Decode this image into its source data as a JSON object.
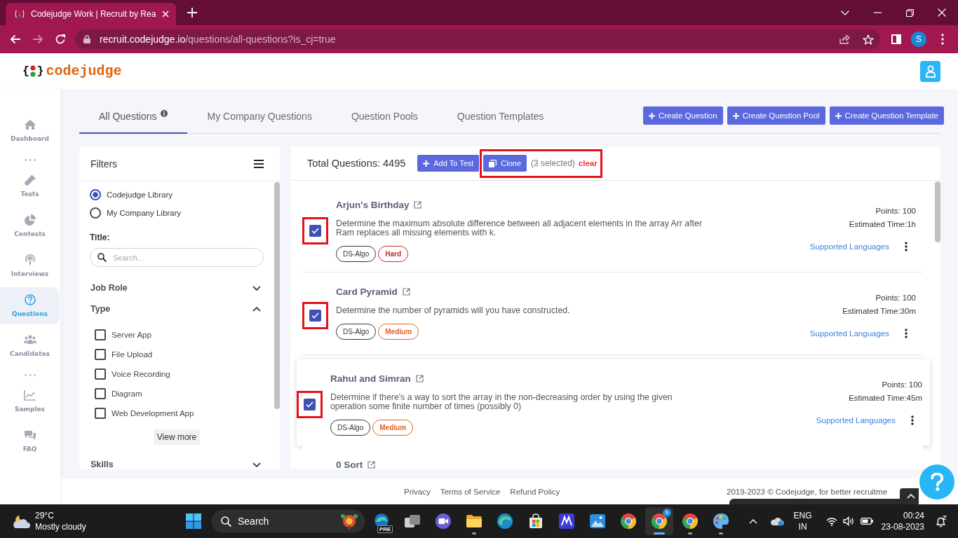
{
  "browser": {
    "tab": {
      "title": "Codejudge Work | Recruit by Rea"
    },
    "address": {
      "host": "recruit.codejudge.io",
      "path": "/questions/all-questions?is_cj=true"
    },
    "profile": "S"
  },
  "header": {
    "logo": {
      "open": "{",
      "close": "}",
      "name": "codejudge"
    }
  },
  "sidebar": {
    "items": [
      {
        "kind": "link",
        "label": "Dashboard",
        "selected": false
      },
      {
        "kind": "dots"
      },
      {
        "kind": "link",
        "label": "Tests",
        "selected": false
      },
      {
        "kind": "link",
        "label": "Contests",
        "selected": false
      },
      {
        "kind": "link",
        "label": "Interviews",
        "selected": false
      },
      {
        "kind": "link",
        "label": "Questions",
        "selected": true
      },
      {
        "kind": "link",
        "label": "Candidates",
        "selected": false
      },
      {
        "kind": "dots"
      },
      {
        "kind": "link",
        "label": "Samples",
        "selected": false
      },
      {
        "kind": "link",
        "label": "FAQ",
        "selected": false
      }
    ]
  },
  "tabs": [
    {
      "label": "All Questions",
      "selected": true,
      "info": true
    },
    {
      "label": "My Company Questions",
      "selected": false,
      "info": false
    },
    {
      "label": "Question Pools",
      "selected": false,
      "info": false
    },
    {
      "label": "Question Templates",
      "selected": false,
      "info": false
    }
  ],
  "actions": [
    "Create Question",
    "Create Question Pool",
    "Create Question Template"
  ],
  "filters": {
    "title": "Filters",
    "library": [
      {
        "label": "Codejudge Library",
        "selected": true
      },
      {
        "label": "My Company Library",
        "selected": false
      }
    ],
    "title_label": "Title:",
    "search": {
      "placeholder": "Search..."
    },
    "sections": [
      {
        "label": "Job Role",
        "expanded": false
      },
      {
        "label": "Type",
        "expanded": true,
        "options": [
          {
            "label": "Server App",
            "checked": false
          },
          {
            "label": "File Upload",
            "checked": false
          },
          {
            "label": "Voice Recording",
            "checked": false
          },
          {
            "label": "Diagram",
            "checked": false
          },
          {
            "label": "Web Development App",
            "checked": false
          }
        ],
        "more": "View more"
      },
      {
        "label": "Skills",
        "expanded": false
      }
    ]
  },
  "list": {
    "total": "Total Questions: 4495",
    "add_button": "Add To Test",
    "clone_button": "Clone",
    "selected_count": "(3 selected)",
    "clear": "clear",
    "highlighted": true,
    "questions": [
      {
        "title": "Arjun's Birthday",
        "description": "Determine the maximum absolute difference between all adjacent elements in the array Arr after Ram replaces all missing elements with k.",
        "tags": [
          {
            "label": "DS-Algo",
            "kind": "topic",
            "color": "#333333"
          },
          {
            "label": "Hard",
            "kind": "difficulty",
            "color": "#c62828"
          }
        ],
        "points": "Points: 100",
        "time": "Estimated Time:1h",
        "languages": "Supported Languages",
        "checked": true,
        "highlighted": true,
        "hovered": false
      },
      {
        "title": "Card Pyramid",
        "description": "Determine the number of pyramids will you have constructed.",
        "tags": [
          {
            "label": "DS-Algo",
            "kind": "topic",
            "color": "#333333"
          },
          {
            "label": "Medium",
            "kind": "difficulty",
            "color": "#e0621e"
          }
        ],
        "points": "Points: 100",
        "time": "Estimated Time:30m",
        "languages": "Supported Languages",
        "checked": true,
        "highlighted": true,
        "hovered": false
      },
      {
        "title": "Rahul and Simran",
        "description": "Determine if there's a way to sort the array in the non-decreasing order by using the given operation some finite number of times (possibly 0)",
        "tags": [
          {
            "label": "DS-Algo",
            "kind": "topic",
            "color": "#333333"
          },
          {
            "label": "Medium",
            "kind": "difficulty",
            "color": "#e0621e"
          }
        ],
        "points": "Points: 100",
        "time": "Estimated Time:45m",
        "languages": "Supported Languages",
        "checked": true,
        "highlighted": true,
        "hovered": true
      },
      {
        "title": "0 Sort"
      }
    ]
  },
  "footer": {
    "links": [
      "Privacy",
      "Terms of Service",
      "Refund Policy"
    ],
    "copyright": "2019-2023 © Codejudge, for better recruitme"
  },
  "taskbar": {
    "weather": {
      "temperature": "29°C",
      "condition": "Mostly cloudy"
    },
    "search": "Search",
    "apps": [
      {
        "kind": "beta",
        "label": "PRE",
        "running": false,
        "selected": false
      },
      {
        "kind": "tasks",
        "running": false,
        "selected": false
      },
      {
        "kind": "meet",
        "running": false,
        "selected": false
      },
      {
        "kind": "folder",
        "running": true,
        "selected": false
      },
      {
        "kind": "edge",
        "running": false,
        "selected": false
      },
      {
        "kind": "store",
        "running": false,
        "selected": false
      },
      {
        "kind": "editor",
        "running": false,
        "selected": false
      },
      {
        "kind": "photos",
        "running": false,
        "selected": false
      },
      {
        "kind": "chrome",
        "running": false,
        "selected": false
      },
      {
        "kind": "chrome",
        "badge": "S",
        "running": true,
        "selected": true
      },
      {
        "kind": "chrome",
        "running": true,
        "selected": false
      },
      {
        "kind": "paint",
        "running": true,
        "selected": false
      }
    ],
    "language": [
      "ENG",
      "IN"
    ],
    "time": "00:24",
    "date": "23-08-2023"
  }
}
